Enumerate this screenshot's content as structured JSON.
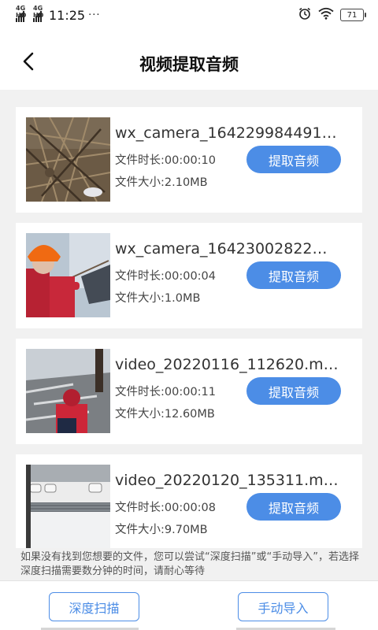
{
  "status_bar": {
    "signal_1_label": "4G HD",
    "signal_2_label": "4G HD",
    "time": "11:25",
    "more": "···",
    "alarm_icon": "alarm-clock-icon",
    "wifi_icon": "wifi-icon",
    "battery_level": "71"
  },
  "header": {
    "back_icon": "chevron-left-icon",
    "title": "视频提取音频"
  },
  "videos": [
    {
      "name": "wx_camera_164229984491…",
      "duration": "文件时长:00:00:10",
      "size": "文件大小:2.10MB",
      "button": "提取音频"
    },
    {
      "name": "wx_camera_16423002822…",
      "duration": "文件时长:00:00:04",
      "size": "文件大小:1.0MB",
      "button": "提取音频"
    },
    {
      "name": "video_20220116_112620.m…",
      "duration": "文件时长:00:00:11",
      "size": "文件大小:12.60MB",
      "button": "提取音频"
    },
    {
      "name": "video_20220120_135311.m…",
      "duration": "文件时长:00:00:08",
      "size": "文件大小:9.70MB",
      "button": "提取音频"
    }
  ],
  "tip": "如果没有找到您想要的文件，您可以尝试“深度扫描”或“手动导入”，若选择深度扫描需要数分钟的时间，请耐心等待",
  "footer": {
    "deep_scan": "深度扫描",
    "manual_import": "手动导入"
  },
  "colors": {
    "accent": "#4c8de6",
    "background": "#f1f1f1",
    "card": "#ffffff"
  }
}
